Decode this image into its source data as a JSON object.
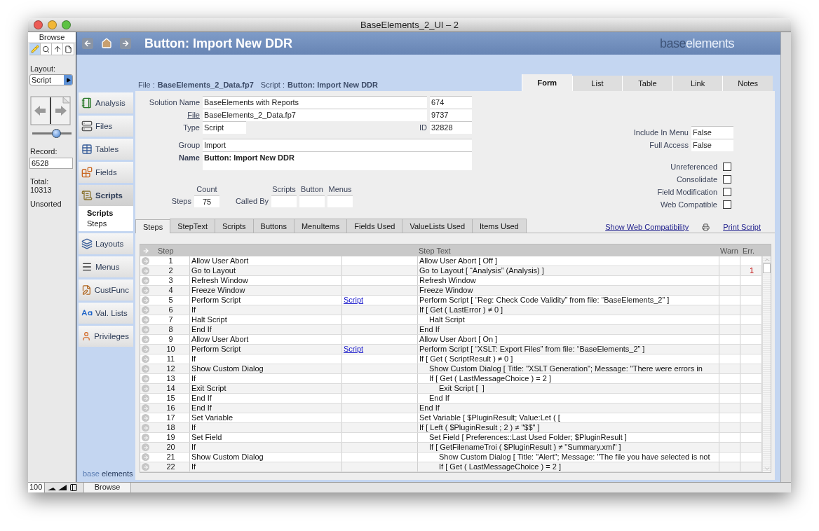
{
  "window": {
    "title": "BaseElements_2_UI – 2"
  },
  "status_panel": {
    "mode_label": "Browse",
    "modes": [
      {
        "selected": true
      },
      {
        "selected": false
      },
      {
        "selected": false
      },
      {
        "selected": false
      }
    ],
    "layout_label": "Layout:",
    "layout_value": "Script",
    "record_slider": {
      "level": 0.6
    },
    "record_label": "Record:",
    "record_value": "6528",
    "total_label": "Total:",
    "total_value": "10313",
    "sort_status": "Unsorted"
  },
  "header": {
    "title": "Button: Import New DDR",
    "logo": [
      "base",
      "elements"
    ]
  },
  "sidebar": {
    "items": [
      {
        "label": "Analysis",
        "selected": false
      },
      {
        "label": "Files",
        "selected": false
      },
      {
        "label": "Tables",
        "selected": false
      },
      {
        "label": "Fields",
        "selected": false
      },
      {
        "label": "Scripts",
        "selected": true,
        "children": [
          {
            "label": "Scripts",
            "selected": true
          },
          {
            "label": "Steps",
            "selected": false
          }
        ]
      },
      {
        "label": "Layouts",
        "selected": false
      },
      {
        "label": "Menus",
        "selected": false
      },
      {
        "label": "CustFunc",
        "selected": false
      },
      {
        "label": "Val. Lists",
        "selected": false
      },
      {
        "label": "Privileges",
        "selected": false
      }
    ],
    "logo": [
      "base",
      "elements"
    ]
  },
  "breadcrumb": {
    "file_label": "File :",
    "file": "BaseElements_2_Data.fp7",
    "script_label": "Script :",
    "script": "Button: Import New DDR"
  },
  "view_tabs": [
    {
      "label": "Form",
      "selected": true
    },
    {
      "label": "List",
      "selected": false
    },
    {
      "label": "Table",
      "selected": false
    },
    {
      "label": "Link",
      "selected": false
    },
    {
      "label": "Notes",
      "selected": false
    }
  ],
  "form": {
    "solution_name": {
      "label": "Solution Name",
      "value": "BaseElements with Reports",
      "number": "674"
    },
    "file": {
      "label": "File",
      "value": "BaseElements_2_Data.fp7",
      "number": "9737"
    },
    "type": {
      "label": "Type",
      "value": "Script",
      "id_label": "ID",
      "id": "32828"
    },
    "group": {
      "label": "Group",
      "value": "Import"
    },
    "name": {
      "label": "Name",
      "value": "Button: Import New DDR"
    },
    "counts": {
      "count_label": "Count",
      "steps_label": "Steps",
      "steps": "75",
      "called_by_label": "Called By",
      "called_by_columns": [
        "Scripts",
        "Button",
        "Menus"
      ]
    },
    "options": [
      {
        "label": "Include In Menu",
        "value": "False"
      },
      {
        "label": "Full Access",
        "value": "False"
      }
    ],
    "flags": [
      {
        "label": "Unreferenced",
        "checked": false
      },
      {
        "label": "Consolidate",
        "checked": false
      },
      {
        "label": "Field Modification",
        "checked": false
      },
      {
        "label": "Web Compatible",
        "checked": false
      }
    ]
  },
  "detail_tabs": [
    {
      "label": "Steps",
      "selected": true
    },
    {
      "label": "StepText",
      "selected": false
    },
    {
      "label": "Scripts",
      "selected": false
    },
    {
      "label": "Buttons",
      "selected": false
    },
    {
      "label": "MenuItems",
      "selected": false
    },
    {
      "label": "Fields Used",
      "selected": false
    },
    {
      "label": "ValueLists Used",
      "selected": false
    },
    {
      "label": "Items Used",
      "selected": false
    }
  ],
  "links": [
    {
      "label": "Show Web Compatibility",
      "kind": "link"
    },
    {
      "label": "Print Script",
      "kind": "print"
    }
  ],
  "steps_table": {
    "columns": [
      "Step",
      "Step Text",
      "Warn",
      "Err."
    ],
    "rows": [
      {
        "number": "1",
        "name": "Allow User Abort",
        "text": "Allow User Abort [ Off ]"
      },
      {
        "number": "2",
        "name": "Go to Layout",
        "text": "Go to Layout [ “Analysis” (Analysis) ]",
        "err": "1"
      },
      {
        "number": "3",
        "name": "Refresh Window",
        "text": "Refresh Window"
      },
      {
        "number": "4",
        "name": "Freeze Window",
        "text": "Freeze Window"
      },
      {
        "number": "5",
        "name": "Perform Script",
        "link": "Script",
        "text": "Perform Script [ “Reg: Check Code Validity” from file: “BaseElements_2” ]"
      },
      {
        "number": "6",
        "name": "If",
        "text": "If [ Get ( LastError ) ≠ 0 ]",
        "children": [
          {
            "number": "7",
            "name": "Halt Script",
            "text": "Halt Script"
          }
        ]
      },
      {
        "number": "8",
        "name": "End If",
        "text": "End If"
      },
      {
        "number": "9",
        "name": "Allow User Abort",
        "text": "Allow User Abort [ On ]"
      },
      {
        "number": "10",
        "name": "Perform Script",
        "link": "Script",
        "text": "Perform Script [ “XSLT: Export Files” from file: “BaseElements_2” ]"
      },
      {
        "number": "11",
        "name": "If",
        "text": "If [ Get ( ScriptResult ) ≠ 0 ]",
        "children": [
          {
            "number": "12",
            "name": "Show Custom Dialog",
            "text": "Show Custom Dialog [ Title: \"XSLT Generation\"; Message: \"There were errors in"
          },
          {
            "number": "13",
            "name": "If",
            "text": "If [ Get ( LastMessageChoice ) = 2 ]",
            "children": [
              {
                "number": "14",
                "name": "Exit Script",
                "text": "Exit Script [  ]"
              }
            ]
          },
          {
            "number": "15",
            "name": "End If",
            "text": "End If"
          }
        ]
      },
      {
        "number": "16",
        "name": "End If",
        "text": "End If"
      },
      {
        "number": "17",
        "name": "Set Variable",
        "text": "Set Variable [ $PluginResult; Value:Let ( ["
      },
      {
        "number": "18",
        "name": "If",
        "text": "If [ Left ( $PluginResult ; 2 ) ≠ \"$$\" ]",
        "children": [
          {
            "number": "19",
            "name": "Set Field",
            "text": "Set Field [ Preferences::Last Used Folder; $PluginResult ]"
          },
          {
            "number": "20",
            "name": "If",
            "text": "If [ GetFilenameTroi ( $PluginResult ) ≠ \"Summary.xml\" ]",
            "children": [
              {
                "number": "21",
                "name": "Show Custom Dialog",
                "text": "Show Custom Dialog [ Title: \"Alert\"; Message: \"The file you have selected is not"
              },
              {
                "number": "22",
                "name": "If",
                "text": "If [ Get ( LastMessageChoice ) = 2 ]"
              }
            ]
          }
        ]
      }
    ]
  },
  "status_bar": {
    "zoom": "100",
    "mode": "Browse"
  }
}
